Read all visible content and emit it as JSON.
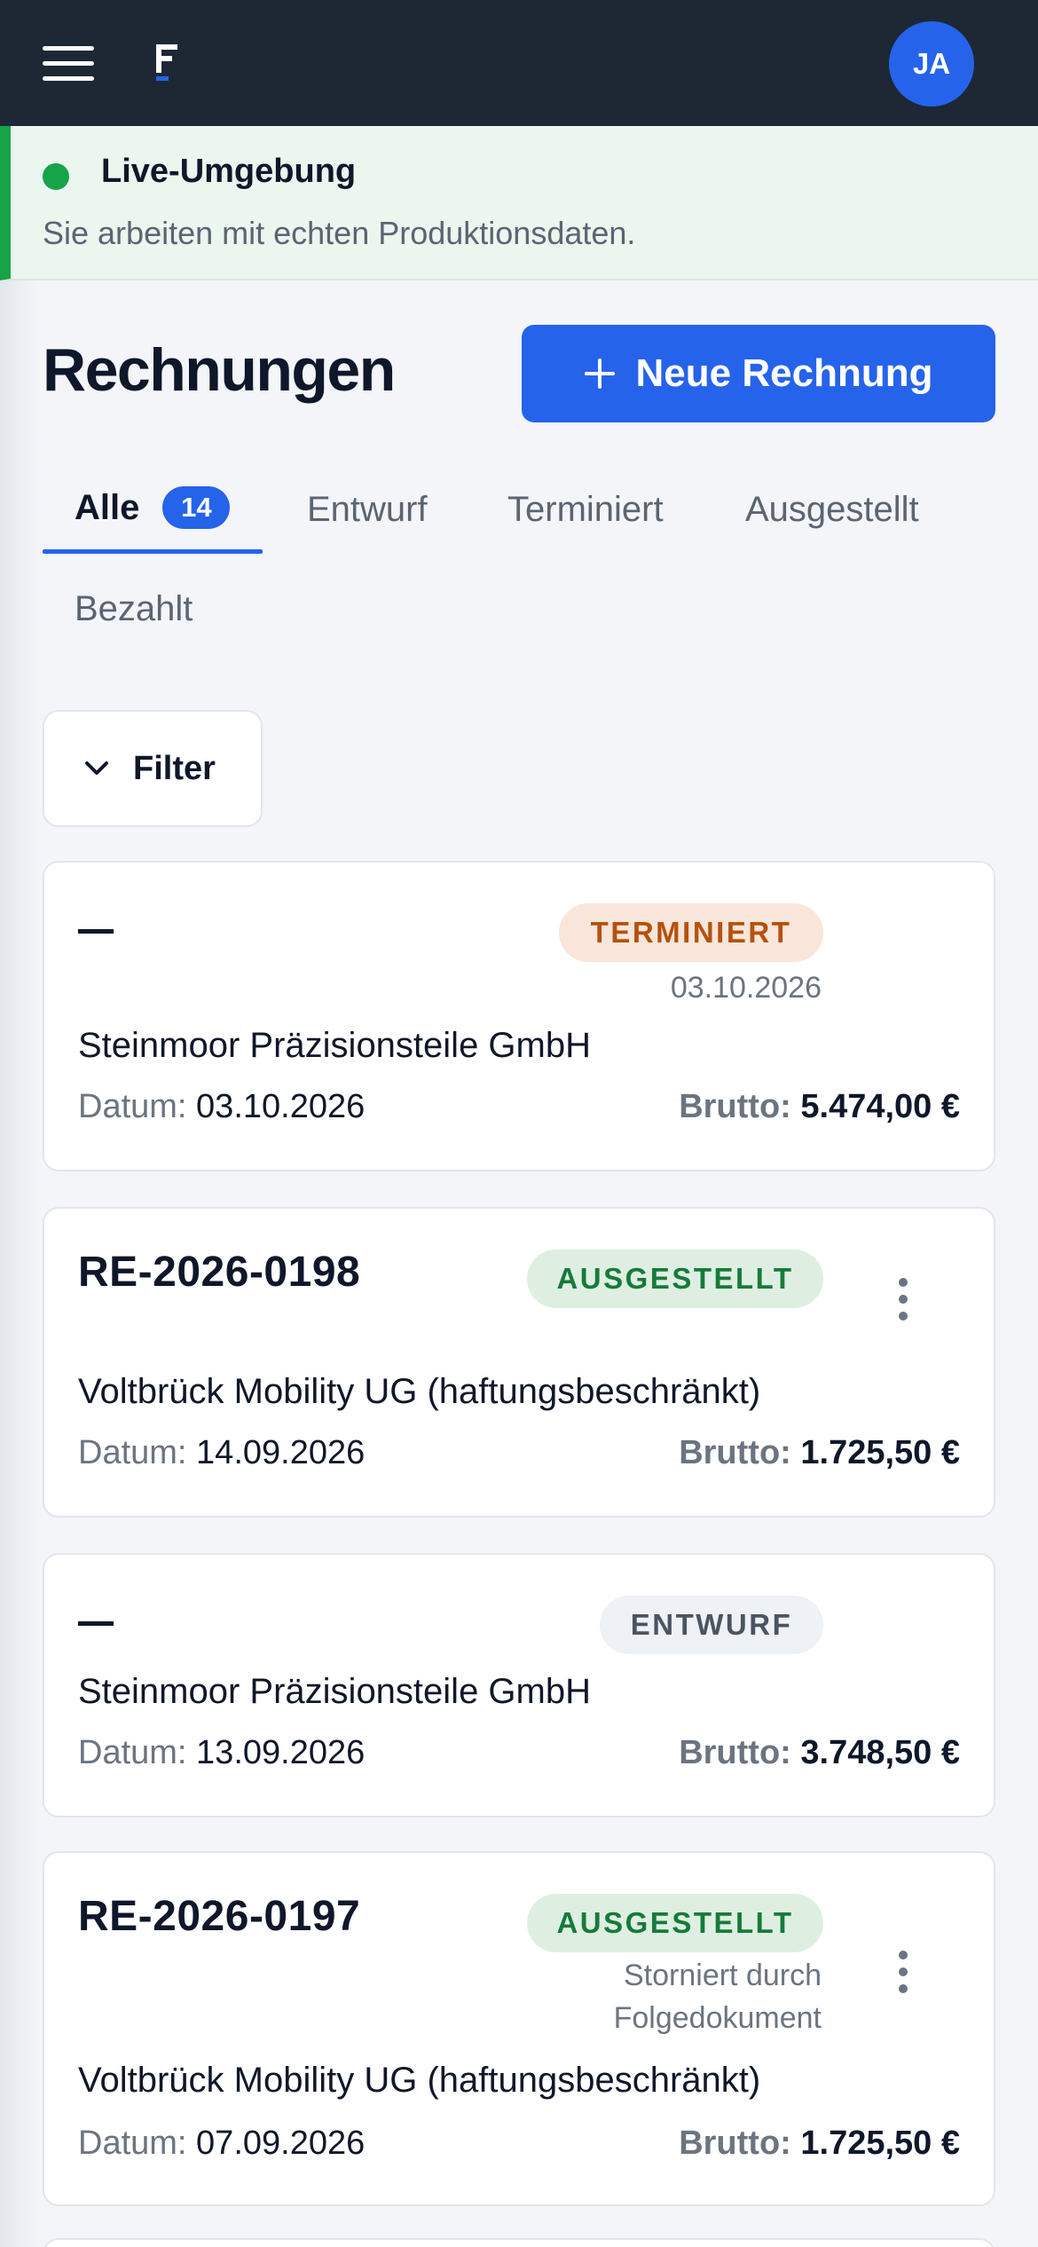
{
  "header": {
    "avatar_initials": "JA",
    "logo_letter": "F"
  },
  "banner": {
    "title": "Live-Umgebung",
    "subtitle": "Sie arbeiten mit echten Produktionsdaten.",
    "status_color": "#16a34a"
  },
  "page": {
    "title": "Rechnungen",
    "new_button_label": "Neue Rechnung"
  },
  "tabs": [
    {
      "label": "Alle",
      "count": "14",
      "active": true
    },
    {
      "label": "Entwurf"
    },
    {
      "label": "Terminiert"
    },
    {
      "label": "Ausgestellt"
    },
    {
      "label": "Bezahlt"
    }
  ],
  "filter": {
    "label": "Filter"
  },
  "labels": {
    "date": "Datum:",
    "gross": "Brutto:"
  },
  "invoices": [
    {
      "number": "",
      "status": "TERMINIERT",
      "status_note": "03.10.2026",
      "customer": "Steinmoor Präzisionsteile GmbH",
      "date": "03.10.2026",
      "gross": "5.474,00 €"
    },
    {
      "number": "RE-2026-0198",
      "status": "AUSGESTELLT",
      "customer": "Voltbrück Mobility UG (haftungsbeschränkt)",
      "date": "14.09.2026",
      "gross": "1.725,50 €"
    },
    {
      "number": "",
      "status": "ENTWURF",
      "customer": "Steinmoor Präzisionsteile GmbH",
      "date": "13.09.2026",
      "gross": "3.748,50 €"
    },
    {
      "number": "RE-2026-0197",
      "status": "AUSGESTELLT",
      "status_note_line1": "Storniert durch",
      "status_note_line2": "Folgedokument",
      "customer": "Voltbrück Mobility UG (haftungsbeschränkt)",
      "date": "07.09.2026",
      "gross": "1.725,50 €"
    }
  ],
  "colors": {
    "topbar": "#1e2734",
    "accent": "#2563eb",
    "status_terminiert": "#b5510c",
    "status_ausgestellt": "#177a3a",
    "status_entwurf": "#4a5463"
  },
  "icons": [
    "menu-icon",
    "logo-icon",
    "plus-icon",
    "chevron-down-icon",
    "more-vertical-icon"
  ]
}
